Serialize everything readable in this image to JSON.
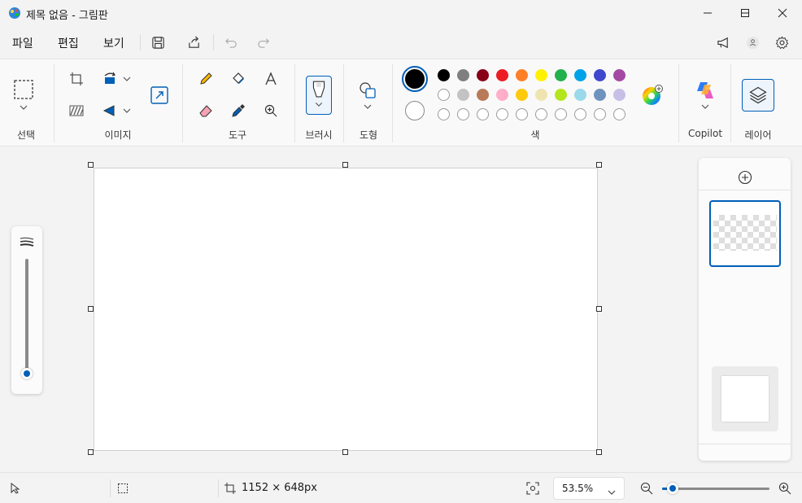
{
  "window": {
    "title": "제목 없음 - 그림판",
    "minimize_icon": "minimize-icon",
    "maximize_icon": "maximize-icon",
    "close_icon": "close-icon"
  },
  "menu": {
    "file": "파일",
    "edit": "편집",
    "view": "보기"
  },
  "ribbon": {
    "groups": {
      "selection": "선택",
      "image": "이미지",
      "tools": "도구",
      "brush": "브러시",
      "shapes": "도형",
      "colors": "색",
      "copilot": "Copilot",
      "layers": "레이어"
    },
    "colors": {
      "primary": "#000000",
      "secondary": "#ffffff",
      "row1": [
        "#000000",
        "#7f7f7f",
        "#880015",
        "#ed1c24",
        "#ff7f27",
        "#fff200",
        "#22b14c",
        "#00a2e8",
        "#3f48cc",
        "#a349a4"
      ],
      "row2": [
        "#ffffff",
        "#c3c3c3",
        "#b97a57",
        "#ffaec9",
        "#ffc90e",
        "#efe4b0",
        "#b5e61d",
        "#99d9ea",
        "#7092be",
        "#c8bfe7"
      ],
      "row3_count": 10
    }
  },
  "status": {
    "canvas_size": "1152 × 648px",
    "zoom": "53.5%",
    "zoom_level": 0.1
  },
  "accent": "#005fb8"
}
